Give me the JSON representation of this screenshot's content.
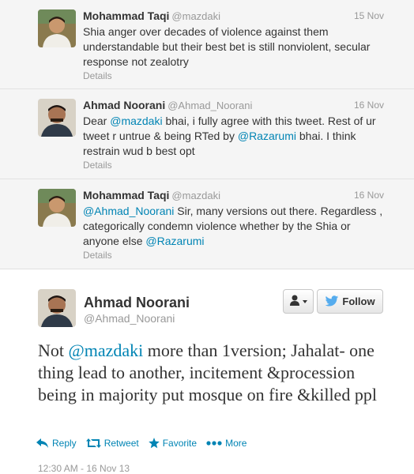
{
  "conversation": [
    {
      "fullname": "Mohammad Taqi",
      "screenname": "@mazdaki",
      "time": "15 Nov",
      "text_parts": [
        {
          "t": "Shia anger over decades of violence against them understandable but their best bet is still nonviolent, secular response not zealotry",
          "link": false
        }
      ],
      "details": "Details"
    },
    {
      "fullname": "Ahmad Noorani",
      "screenname": "@Ahmad_Noorani",
      "time": "16 Nov",
      "text_parts": [
        {
          "t": "Dear ",
          "link": false
        },
        {
          "t": "@mazdaki",
          "link": true
        },
        {
          "t": " bhai, i fully agree with this tweet. Rest of ur tweet r untrue & being RTed by ",
          "link": false
        },
        {
          "t": "@Razarumi",
          "link": true
        },
        {
          "t": " bhai. I think restrain wud b best opt",
          "link": false
        }
      ],
      "details": "Details"
    },
    {
      "fullname": "Mohammad Taqi",
      "screenname": "@mazdaki",
      "time": "16 Nov",
      "text_parts": [
        {
          "t": "@Ahmad_Noorani",
          "link": true
        },
        {
          "t": " Sir, many versions out there. Regardless , categorically condemn violence whether by the Shia or anyone else ",
          "link": false
        },
        {
          "t": "@Razarumi",
          "link": true
        }
      ],
      "details": "Details"
    }
  ],
  "main": {
    "fullname": "Ahmad Noorani",
    "screenname": "@Ahmad_Noorani",
    "follow_label": "Follow",
    "text_parts": [
      {
        "t": "Not ",
        "link": false
      },
      {
        "t": "@mazdaki",
        "link": true
      },
      {
        "t": " more than 1version; Jahalat- one thing lead to another, incitement &procession being in majority put mosque on fire &killed ppl",
        "link": false
      }
    ],
    "actions": {
      "reply": "Reply",
      "retweet": "Retweet",
      "favorite": "Favorite",
      "more": "More"
    },
    "timestamp": "12:30 AM - 16 Nov 13"
  },
  "colors": {
    "link": "#0084b4",
    "muted": "#999999",
    "thread_bg": "#f5f5f5",
    "twitter_bird": "#55acee",
    "favorite_star": "#0084b4"
  },
  "icons": {
    "user_dropdown": "user-icon",
    "follow": "twitter-bird-icon",
    "reply": "reply-icon",
    "retweet": "retweet-icon",
    "favorite": "star-icon",
    "more": "ellipsis-icon"
  }
}
